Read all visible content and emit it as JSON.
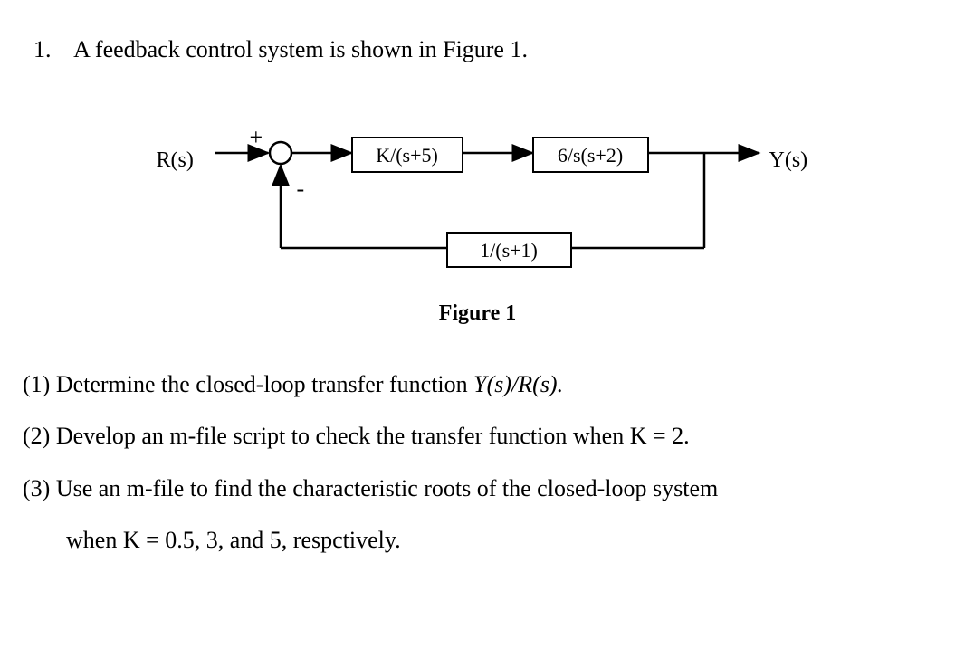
{
  "problem": {
    "number": "1.",
    "intro": "A feedback control system is shown in Figure 1."
  },
  "diagram": {
    "input_label": "R(s)",
    "output_label": "Y(s)",
    "plus_sign": "+",
    "minus_sign": "-",
    "block1": "K/(s+5)",
    "block2": "6/s(s+2)",
    "feedback_block": "1/(s+1)",
    "caption": "Figure 1"
  },
  "questions": {
    "q1_prefix": "(1) Determine the closed-loop transfer function ",
    "q1_expr": "Y(s)/R(s).",
    "q2": "(2) Develop an m-file script to check the transfer function when K = 2.",
    "q3": "(3) Use an m-file to find the characteristic roots of the closed-loop system",
    "q3_cont": "when  K = 0.5,  3, and 5,  respctively."
  }
}
